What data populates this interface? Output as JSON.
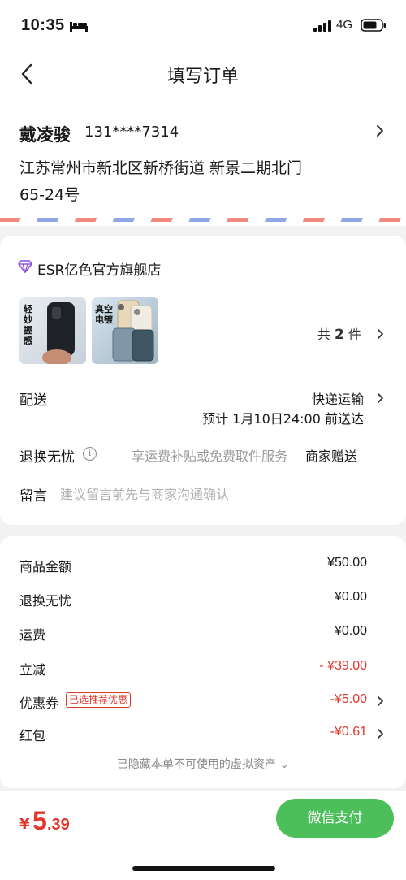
{
  "status_bar": {
    "time": "10:35",
    "network": "4G",
    "icons": [
      "bed-icon",
      "signal-icon",
      "battery-icon"
    ]
  },
  "nav": {
    "title": "填写订单",
    "back_icon": "chevron-left-icon"
  },
  "address": {
    "name": "戴凌骏",
    "phone": "131****7314",
    "line1": "江苏常州市新北区新桥街道 新景二期北门",
    "line2": "65-24号"
  },
  "shop": {
    "name": "ESR亿色官方旗舰店",
    "icon": "diamond-icon",
    "thumbnails": [
      {
        "label_lines": [
          "轻",
          "妙",
          "握",
          "感"
        ]
      },
      {
        "label_lines": [
          "真空",
          "电镀"
        ]
      }
    ],
    "count_prefix": "共",
    "count": "2",
    "count_suffix": "件"
  },
  "delivery": {
    "label": "配送",
    "method": "快递运输",
    "eta": "预计 1月10日24:00 前送达"
  },
  "return_service": {
    "label": "退换无忧",
    "info_icon": "i",
    "description": "享运费补贴或免费取件服务",
    "value": "商家赠送"
  },
  "memo": {
    "label": "留言",
    "placeholder": "建议留言前先与商家沟通确认"
  },
  "price": {
    "goods_label": "商品金额",
    "goods_value": "¥50.00",
    "return_label": "退换无忧",
    "return_value": "¥0.00",
    "shipping_label": "运费",
    "shipping_value": "¥0.00",
    "discount_label": "立减",
    "discount_value": "- ¥39.00",
    "coupon_label": "优惠券",
    "coupon_tag": "已选推荐优惠",
    "coupon_value": "-¥5.00",
    "redpacket_label": "红包",
    "redpacket_value": "-¥0.61",
    "hidden_note": "已隐藏本单不可使用的虚拟资产 ⌄"
  },
  "bottom": {
    "currency": "¥",
    "total_int": "5",
    "total_dec": ".39",
    "pay_label": "微信支付"
  },
  "colors": {
    "accent_red": "#e2382b",
    "pay_green": "#4cbf5a",
    "background": "#f2f2f2"
  }
}
